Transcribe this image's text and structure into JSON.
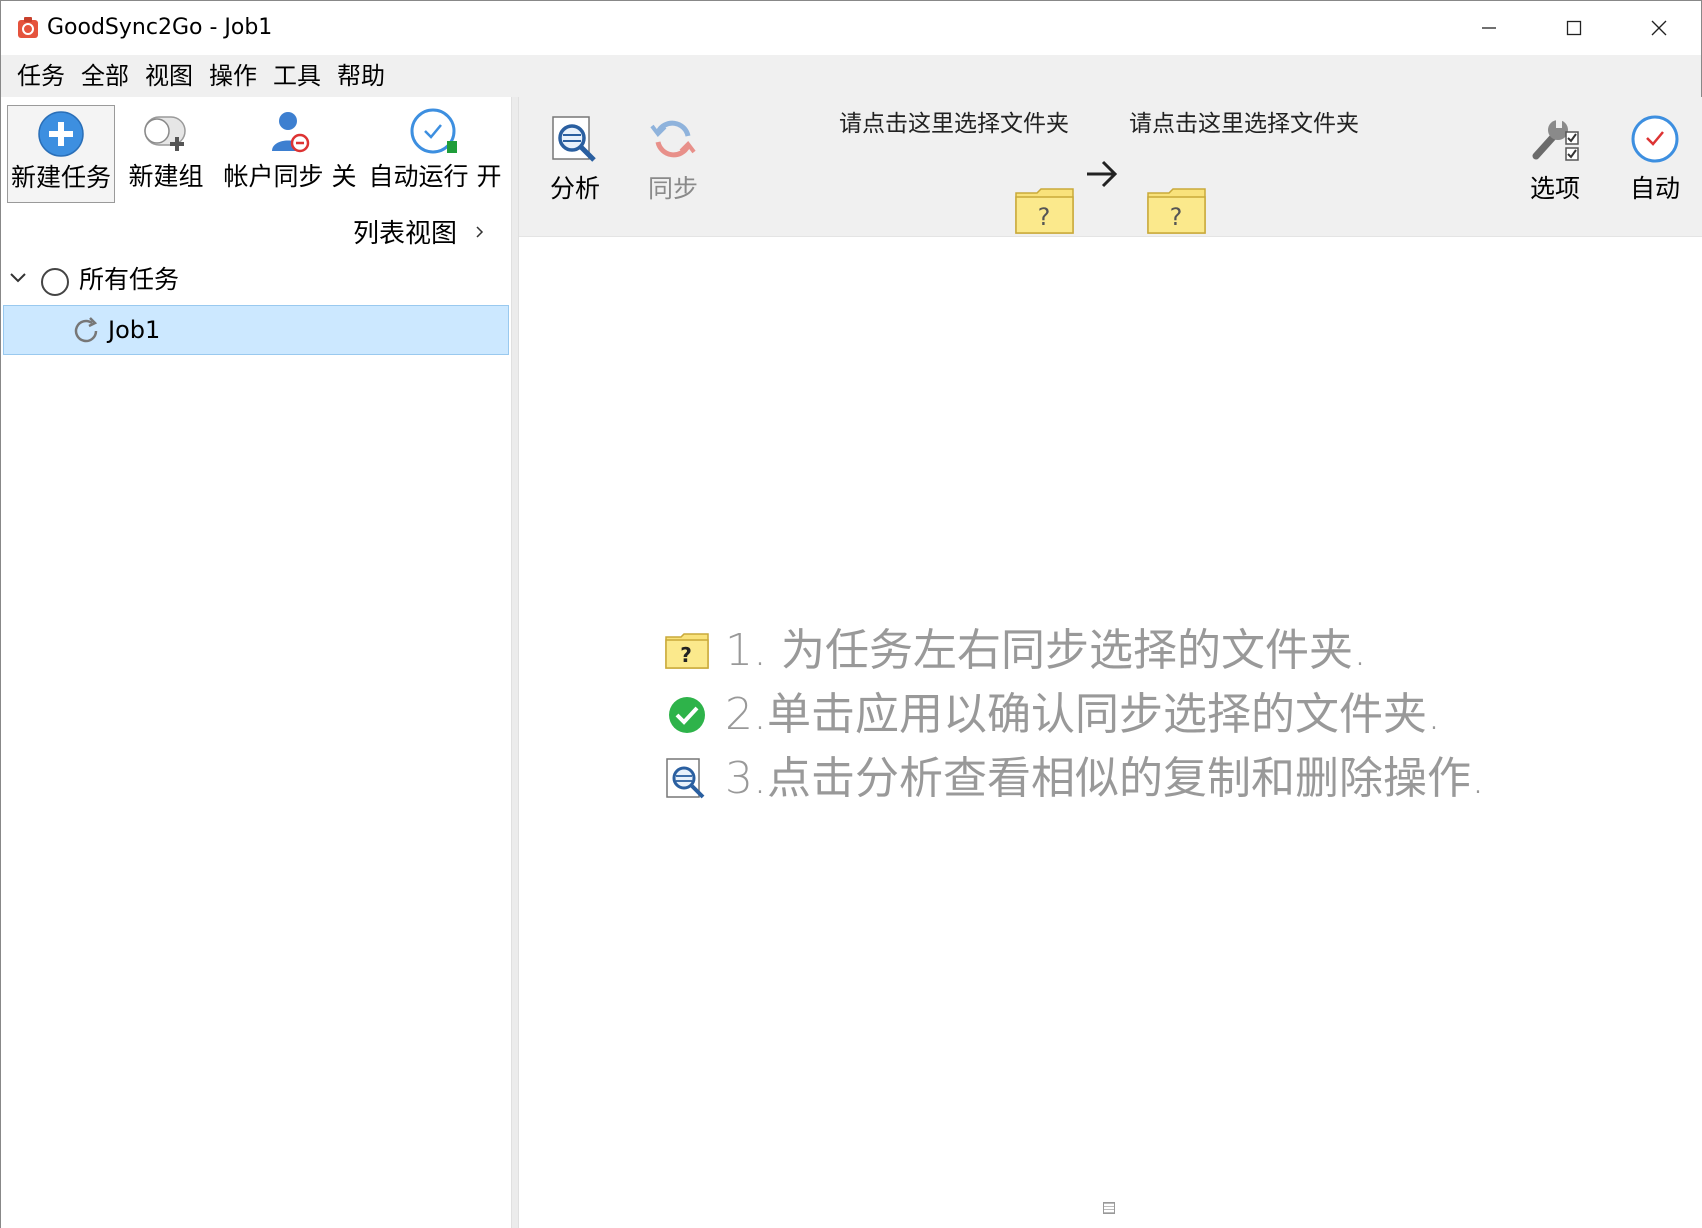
{
  "window": {
    "title": "GoodSync2Go - Job1"
  },
  "menu": [
    "任务",
    "全部",
    "视图",
    "操作",
    "工具",
    "帮助"
  ],
  "left_toolbar": {
    "new_job": "新建任务",
    "new_group": "新建组",
    "account_sync": "帐户同步 关",
    "auto_run": "自动运行 开"
  },
  "list_view": "列表视图",
  "tree": {
    "root": "所有任务",
    "job": "Job1"
  },
  "right_toolbar": {
    "analyze": "分析",
    "sync": "同步",
    "left_folder_hint": "请点击这里选择文件夹",
    "right_folder_hint": "请点击这里选择文件夹",
    "options": "选项",
    "auto": "自动"
  },
  "steps": [
    "1. 为任务左右同步选择的文件夹.",
    "2.单击应用以确认同步选择的文件夹.",
    "3.点击分析查看相似的复制和删除操作."
  ],
  "icons": {
    "app": "goodsync-app-icon",
    "new_job": "plus-circle-icon",
    "new_group": "add-group-icon",
    "account": "user-sync-icon",
    "auto_run": "clock-icon",
    "analyze": "magnifier-icon",
    "sync": "sync-arrows-icon",
    "folder": "question-folder-icon",
    "options": "wrench-checklist-icon",
    "auto": "clock-icon",
    "check": "green-check-icon"
  },
  "colors": {
    "selection": "#cce8ff",
    "accent_blue": "#3d8fe0",
    "folder_yellow": "#f9e27b",
    "check_green": "#2eb34a",
    "step_text": "#999999"
  }
}
